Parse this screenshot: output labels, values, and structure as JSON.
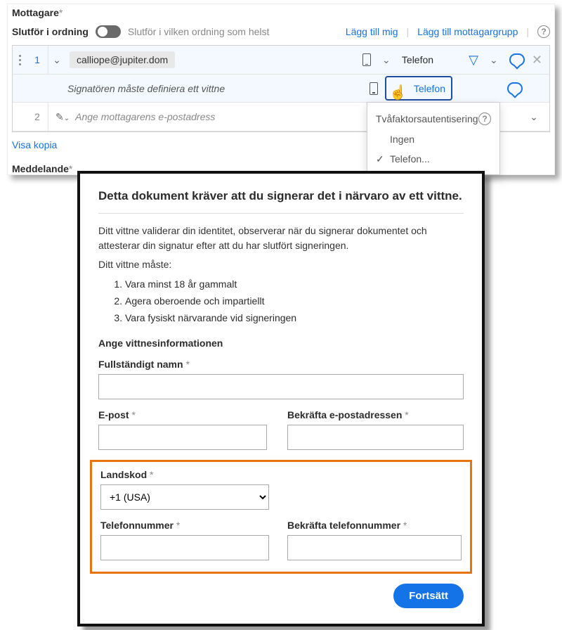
{
  "recipients": {
    "title": "Mottagare",
    "order_label": "Slutför i ordning",
    "toggle_text": "Slutför i vilken ordning som helst",
    "add_me": "Lägg till mig",
    "add_group": "Lägg till mottagargrupp",
    "row1": {
      "num": "1",
      "email": "calliope@jupiter.dom",
      "auth": "Telefon"
    },
    "witness_text": "Signatören måste definiera ett vittne",
    "witness_auth": "Telefon",
    "row2": {
      "num": "2",
      "placeholder": "Ange mottagarens e-postadress"
    },
    "show_copy": "Visa kopia",
    "message_label": "Meddelande"
  },
  "dropdown": {
    "header": "Tvåfaktorsautentisering",
    "items": [
      "Ingen",
      "Telefon..."
    ]
  },
  "modal": {
    "title": "Detta dokument kräver att du signerar det i närvaro av ett vittne.",
    "intro": "Ditt vittne validerar din identitet, observerar när du signerar dokumentet och attesterar din signatur efter att du har slutfört signeringen.",
    "must": "Ditt vittne måste:",
    "rules": [
      "Vara minst 18 år gammalt",
      "Agera oberoende och impartiellt",
      "Vara fysiskt närvarande vid signeringen"
    ],
    "subhead": "Ange vittnesinformationen",
    "fullname": "Fullständigt namn",
    "email": "E-post",
    "confirm_email": "Bekräfta e-postadressen",
    "country": "Landskod",
    "country_value": "+1 (USA)",
    "phone": "Telefonnummer",
    "confirm_phone": "Bekräfta telefonnummer",
    "continue": "Fortsätt"
  }
}
